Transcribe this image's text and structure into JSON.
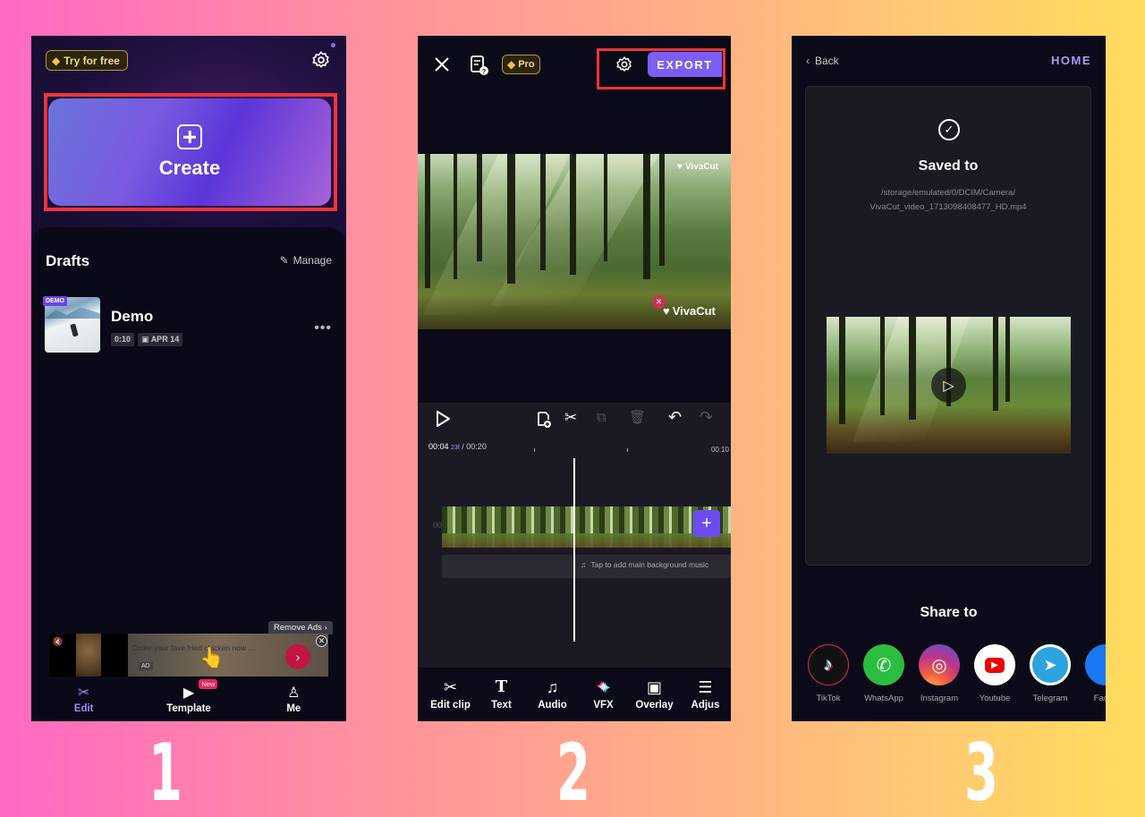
{
  "steps": [
    "1",
    "2",
    "3"
  ],
  "screen1": {
    "try_badge": "Try for free",
    "create_label": "Create",
    "drafts_title": "Drafts",
    "manage_label": "Manage",
    "draft": {
      "tag": "DEMO",
      "name": "Demo",
      "duration": "0:10",
      "date": "APR 14"
    },
    "remove_ads": "Remove Ads ›",
    "ad": {
      "text": "Order your fave fried chicken now ...",
      "label": "AD",
      "go": "›",
      "close": "✕"
    },
    "nav": [
      {
        "label": "Edit",
        "icon": "scissors-icon",
        "active": true
      },
      {
        "label": "Template",
        "icon": "template-icon",
        "badge": "New"
      },
      {
        "label": "Me",
        "icon": "profile-icon"
      }
    ]
  },
  "screen2": {
    "pro_badge": "Pro",
    "export_label": "EXPORT",
    "watermark": "VivaCut",
    "time": {
      "current": "00:04",
      "frame": "23f",
      "total": "/ 00:20",
      "marker": "00:10"
    },
    "music_hint": "Tap to add main background music",
    "tools": [
      {
        "label": "Edit clip",
        "icon": "✂"
      },
      {
        "label": "Text",
        "icon": "T"
      },
      {
        "label": "Audio",
        "icon": "♫"
      },
      {
        "label": "VFX",
        "icon": "✦"
      },
      {
        "label": "Overlay",
        "icon": "▣"
      },
      {
        "label": "Adjus",
        "icon": "☰"
      }
    ]
  },
  "screen3": {
    "back_label": "Back",
    "home_label": "HOME",
    "saved_title": "Saved to",
    "saved_path_line1": "/storage/emulated/0/DCIM/Camera/",
    "saved_path_line2": "VivaCut_video_1713098408477_HD.mp4",
    "share_title": "Share to",
    "share_targets": [
      {
        "label": "TikTok",
        "color": "#111111"
      },
      {
        "label": "WhatsApp",
        "color": "#2bbd3f"
      },
      {
        "label": "Instagram",
        "color": "#d6336c"
      },
      {
        "label": "Youtube",
        "color": "#ffffff"
      },
      {
        "label": "Telegram",
        "color": "#2ca3df"
      },
      {
        "label": "Faceb",
        "color": "#1a77f2"
      }
    ]
  }
}
